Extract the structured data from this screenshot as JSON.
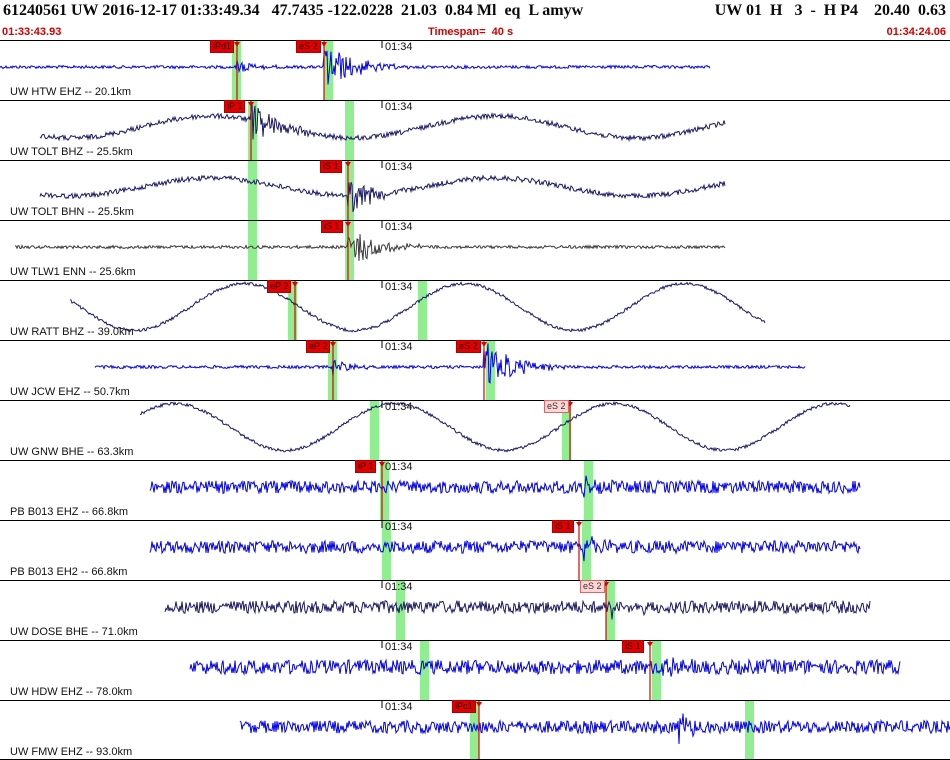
{
  "header": {
    "line1_left": "61240561 UW 2016-12-17 01:33:49.34   47.7435 -122.0228  21.03  0.84 Ml  eq  L amyw",
    "line1_right": "UW 01  H   3  -  H P4    20.40  0.63",
    "start_time": "01:33:43.93",
    "timespan": "Timespan=  40 s",
    "end_time": "01:34:24.06"
  },
  "colors": {
    "header_text": "#0a0a0a",
    "header_red": "#d20000",
    "blue_trace": "#0000ee",
    "dark_trace": "#1a1a66",
    "gray_trace": "#3a3a3a",
    "green_window": "#90ee90",
    "pick_red": "#e00000",
    "pick_pink": "#ffd6d6"
  },
  "minute_label": "01:34",
  "traces": [
    {
      "label": "UW HTW EHZ -- 20.1km",
      "color": "blue",
      "style": "burst",
      "picks": [
        {
          "text": "iPd1",
          "style": "red"
        },
        {
          "text": "eS 2",
          "style": "red"
        }
      ]
    },
    {
      "label": "UW TOLT BHZ -- 25.5km",
      "color": "dark",
      "style": "wave",
      "picks": [
        {
          "text": "iP 1",
          "style": "red"
        }
      ]
    },
    {
      "label": "UW TOLT BHN -- 25.5km",
      "color": "dark",
      "style": "wave",
      "picks": [
        {
          "text": "iS 1",
          "style": "red"
        }
      ]
    },
    {
      "label": "UW TLW1 ENN -- 25.6km",
      "color": "gray",
      "style": "burst",
      "picks": [
        {
          "text": "iS 1",
          "style": "red"
        }
      ]
    },
    {
      "label": "UW RATT BHZ -- 39.0km",
      "color": "dark",
      "style": "swell",
      "picks": [
        {
          "text": "eP 2",
          "style": "red"
        }
      ]
    },
    {
      "label": "UW JCW EHZ -- 50.7km",
      "color": "blue",
      "style": "burst",
      "picks": [
        {
          "text": "eP 2",
          "style": "red"
        },
        {
          "text": "eS 2",
          "style": "red"
        }
      ]
    },
    {
      "label": "UW GNW BHE -- 63.3km",
      "color": "dark",
      "style": "swell",
      "picks": [
        {
          "text": "eS 2",
          "style": "pink"
        }
      ]
    },
    {
      "label": "PB B013 EHZ -- 66.8km",
      "color": "blue",
      "style": "noise",
      "picks": [
        {
          "text": "iP 1",
          "style": "red"
        }
      ]
    },
    {
      "label": "PB B013 EH2 -- 66.8km",
      "color": "blue",
      "style": "noise",
      "picks": [
        {
          "text": "iS 1",
          "style": "red"
        }
      ]
    },
    {
      "label": "UW DOSE BHE -- 71.0km",
      "color": "dark",
      "style": "noise",
      "picks": [
        {
          "text": "eS 2",
          "style": "pink"
        }
      ]
    },
    {
      "label": "UW HDW EHZ -- 78.0km",
      "color": "blue",
      "style": "noise",
      "picks": [
        {
          "text": "iS 1",
          "style": "red"
        }
      ]
    },
    {
      "label": "UW FMW EHZ -- 93.0km",
      "color": "blue",
      "style": "noise",
      "picks": [
        {
          "text": "iPc1",
          "style": "red"
        }
      ]
    }
  ]
}
